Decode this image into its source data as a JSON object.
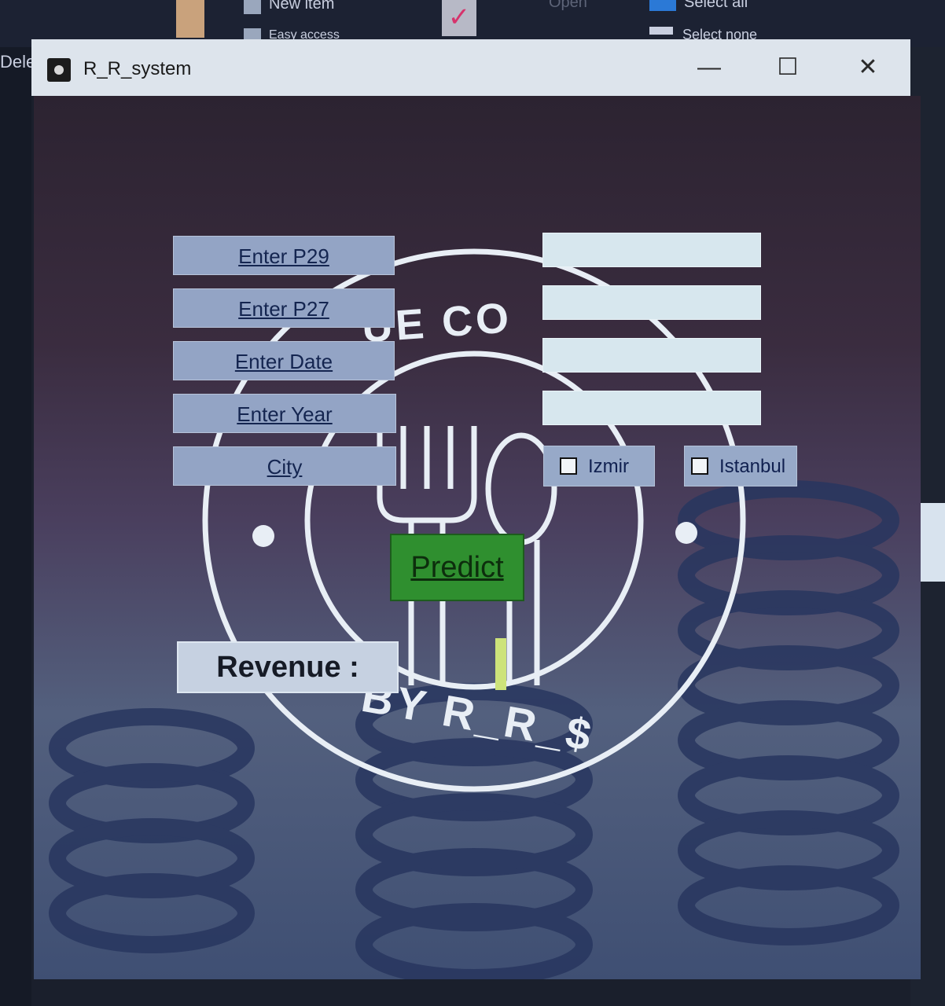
{
  "background": {
    "ribbon": {
      "new_item": "New item",
      "easy_access": "Easy access",
      "open": "Open",
      "select_all": "Select all",
      "select_none": "Select none",
      "delete": "Dele"
    }
  },
  "window": {
    "title": "R_R_system",
    "controls": {
      "minimize": "—",
      "maximize": "☐",
      "close": "✕"
    }
  },
  "form": {
    "labels": {
      "p29": "Enter  P29",
      "p27": "Enter  P27",
      "date": "Enter Date",
      "year": "Enter  Year",
      "city": "City"
    },
    "entries": {
      "p29": "",
      "p27": "",
      "date": "",
      "year": ""
    },
    "cities": [
      {
        "label": "Izmir",
        "checked": false
      },
      {
        "label": "Istanbul",
        "checked": false
      }
    ],
    "predict_label": "Predict",
    "revenue_label": "Revenue :"
  },
  "logo": {
    "top_text": "UE CO",
    "bottom_text": "BY R_R_$"
  },
  "colors": {
    "label_bg": "#93a4c5",
    "entry_bg": "#d7e7ee",
    "predict_bg": "#2f8f2f",
    "revenue_bg": "#c6d1e1"
  }
}
